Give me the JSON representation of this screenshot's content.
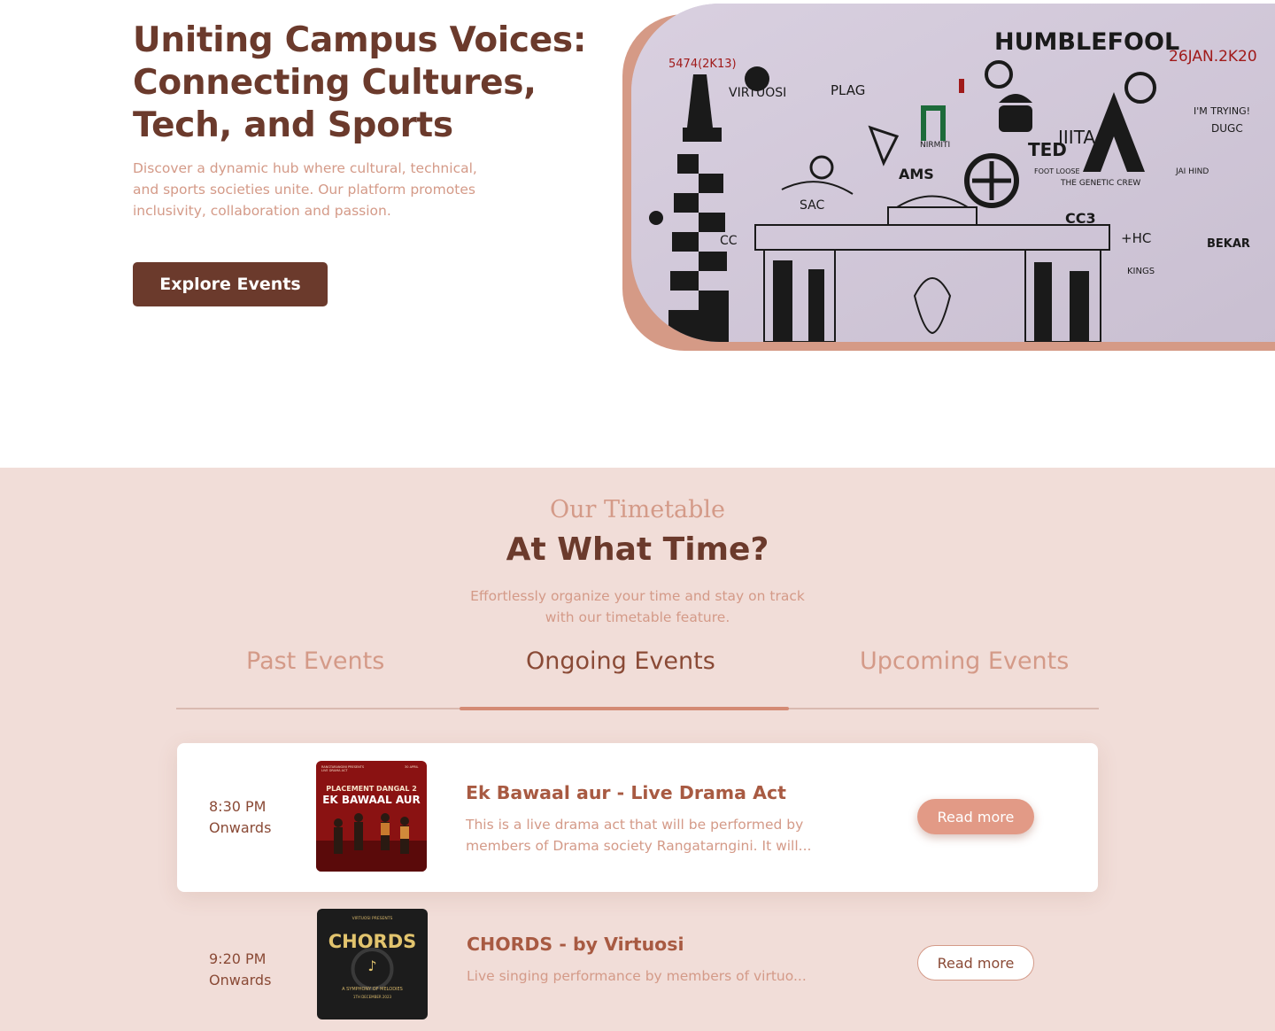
{
  "hero": {
    "title": "Uniting Campus Voices: Connecting Cultures, Tech, and Sports",
    "description": "Discover a dynamic hub where cultural, technical, and sports societies unite. Our platform promotes inclusivity, collaboration and passion.",
    "cta_label": "Explore Events",
    "mural_texts": {
      "humblefool": "HUMBLEFOOL",
      "date": "26JAN.2K20",
      "tag_5474": "5474(2K13)",
      "virtuosi": "VIRTUOSI",
      "plag": "PLAG",
      "ams": "AMS",
      "sac": "SAC",
      "ted": "TED",
      "iiita": "IIITA",
      "genetic": "THE GENETIC CREW",
      "cc3": "CC3",
      "hc": "+HC",
      "dugc": "DUGC",
      "trying": "I'M TRYING!",
      "bekar": "BEKAR",
      "kings": "KINGS",
      "cc": "CC",
      "nirmiti": "NIRMITI",
      "foot_loose": "FOOT LOOSE",
      "jai_hind": "JAI HIND"
    }
  },
  "timetable": {
    "eyebrow": "Our Timetable",
    "title": "At What Time?",
    "description": "Effortlessly organize your time and stay on track with our timetable feature.",
    "tabs": [
      {
        "label": "Past Events"
      },
      {
        "label": "Ongoing Events"
      },
      {
        "label": "Upcoming Events"
      }
    ],
    "active_tab": "Ongoing Events",
    "events": [
      {
        "time": "8:30 PM",
        "time_suffix": "Onwards",
        "title": "Ek Bawaal aur - Live Drama Act",
        "description": "This is a live drama act that will be performed by members of Drama society Rangatarngini. It will...",
        "button": "Read more",
        "poster": {
          "top_left": "RANGTARANGINI PRESENTS",
          "top_left_2": "LIVE DRAMA ACT",
          "top_right": "30 APRIL",
          "line1": "PLACEMENT DANGAL 2",
          "line2": "EK BAWAAL AUR"
        }
      },
      {
        "time": "9:20 PM",
        "time_suffix": "Onwards",
        "title": "CHORDS - by Virtuosi",
        "description": "Live singing performance by members of virtuo...",
        "button": "Read more",
        "poster": {
          "top": "VIRTUOSI PRESENTS",
          "name": "CHORDS",
          "subtitle": "A SYMPHONY OF MELODIES",
          "date": "1TH DECEMBER 2023"
        }
      }
    ]
  },
  "colors": {
    "brand_dark": "#6b3a2c",
    "accent": "#e29a86",
    "muted": "#d49a88",
    "section_bg": "#f1ddd8"
  }
}
